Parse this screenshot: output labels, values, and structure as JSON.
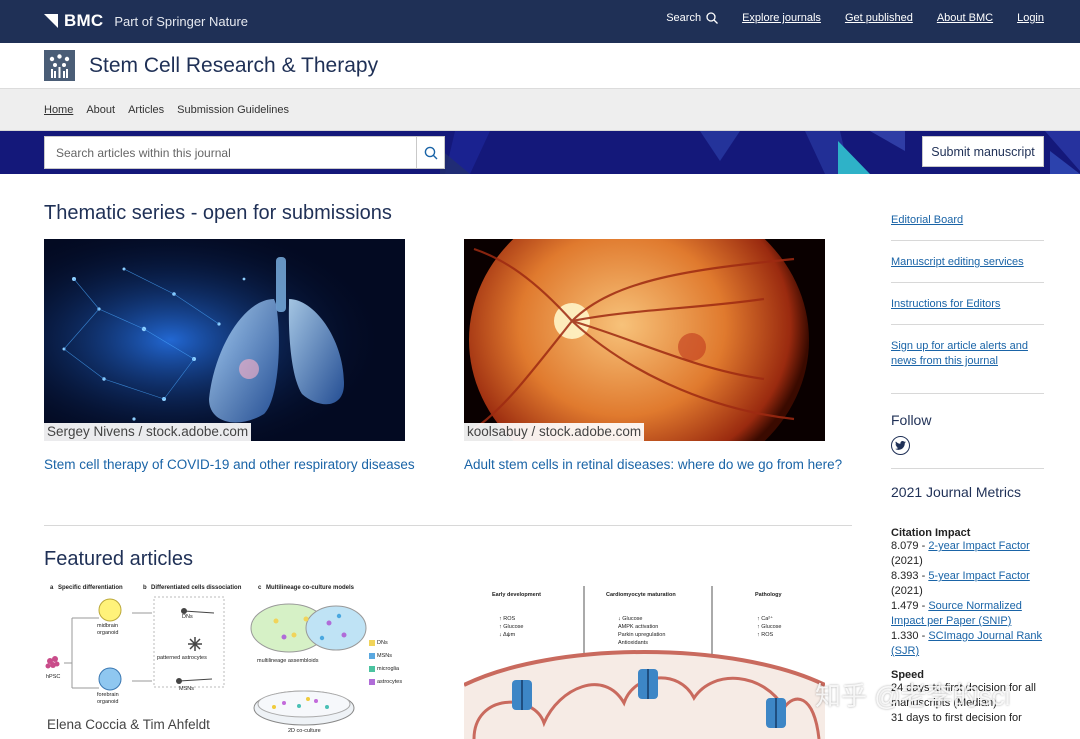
{
  "topbar": {
    "brand": "BMC",
    "brand_sub": "Part of Springer Nature",
    "search_label": "Search",
    "nav": [
      "Explore journals",
      "Get published",
      "About BMC",
      "Login"
    ]
  },
  "journal": {
    "title": "Stem Cell Research & Therapy"
  },
  "subnav": [
    "Home",
    "About",
    "Articles",
    "Submission Guidelines"
  ],
  "search": {
    "placeholder": "Search articles within this journal"
  },
  "submit_label": "Submit manuscript",
  "thematic": {
    "heading": "Thematic series - open for submissions",
    "cards": [
      {
        "credit": "Sergey Nivens / stock.adobe.com",
        "title": "Stem cell therapy of COVID-19 and other respiratory diseases"
      },
      {
        "credit": "koolsabuy / stock.adobe.com",
        "title": "Adult stem cells in retinal diseases: where do we go from here?"
      }
    ]
  },
  "featured": {
    "heading": "Featured articles",
    "fig1": {
      "credit": "Elena Coccia & Tim Ahfeldt",
      "panel_a": "a",
      "panel_a_label": "Specific differentiation",
      "panel_b": "b",
      "panel_b_label": "Differentiated cells dissociation",
      "panel_c": "c",
      "panel_c_label": "Multilineage co-culture models",
      "midbrain": "midbrain",
      "organoid": "organoid",
      "forebrain": "forebrain",
      "hpsc": "hPSC",
      "dns": "DNs",
      "patterned": "patterned astrocytes",
      "msns": "MSNs",
      "assembloids": "multilineage assembloids",
      "coculture": "2D co-culture",
      "legend": [
        "DNs",
        "MSNs",
        "microglia",
        "astrocytes"
      ]
    },
    "fig2": {
      "cols": [
        "Early development",
        "Cardiomyocyte maturation",
        "Pathology"
      ],
      "col1": [
        "↑ ROS",
        "↑ Glucose",
        "↓ Δψm"
      ],
      "col2": [
        "↓ Glucose",
        "AMPK activation",
        "Parkin upregulation",
        "Antioxidants"
      ],
      "col3": [
        "↑ Ca²⁺",
        "↑ Glucose",
        "↑ ROS"
      ]
    }
  },
  "sidebar": {
    "links": [
      "Editorial Board",
      "Manuscript editing services",
      "Instructions for Editors",
      "Sign up for article alerts and news from this journal"
    ],
    "follow": "Follow",
    "metrics_title": "2021 Journal Metrics",
    "citation_impact": "Citation Impact",
    "metrics": [
      {
        "value": "8.079 - ",
        "link": "2-year Impact Factor",
        "suffix": " (2021)"
      },
      {
        "value": "8.393 - ",
        "link": "5-year Impact Factor",
        "suffix": " (2021)"
      },
      {
        "value": "1.479 - ",
        "link": "Source Normalized Impact per Paper (SNIP)",
        "suffix": ""
      },
      {
        "value": "1.330 - ",
        "link": "SCImago Journal Rank (SJR)",
        "suffix": ""
      }
    ],
    "speed_title": "Speed",
    "speed": [
      "24 days to first decision for all manuscripts (Median)",
      "31 days to first decision for"
    ]
  },
  "watermark": "知乎 @老李的sci",
  "colors": {
    "navy": "#1f3056",
    "banner": "#14187a",
    "link": "#1a64a7",
    "accent": "#2eb2c8"
  }
}
